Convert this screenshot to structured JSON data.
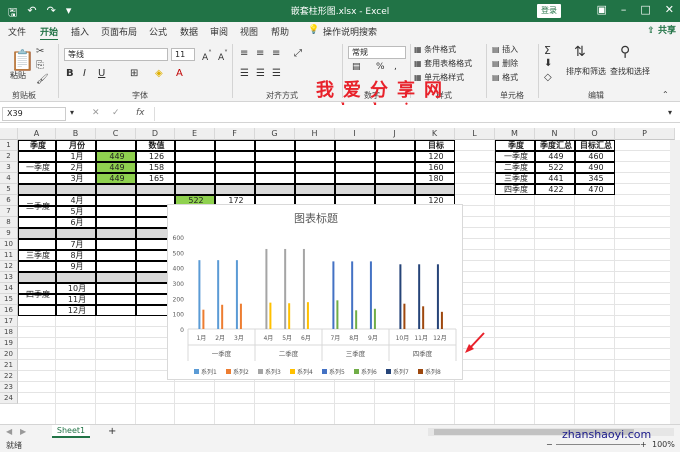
{
  "window": {
    "title": "嵌套柱形图.xlsx  -  Excel",
    "login": "登录"
  },
  "tabs": [
    "文件",
    "开始",
    "插入",
    "页面布局",
    "公式",
    "数据",
    "审阅",
    "视图",
    "帮助"
  ],
  "tell_me": "操作说明搜索",
  "share": "共享",
  "ribbon": {
    "paste": "粘贴",
    "clipboard": "剪贴板",
    "font_name": "等线",
    "font_size": "11",
    "font_group": "字体",
    "align_group": "对齐方式",
    "number_format": "常规",
    "number_group": "数字",
    "cond_format": "条件格式",
    "table_format": "套用表格格式",
    "cell_style": "单元格样式",
    "styles_group": "样式",
    "insert": "插入",
    "delete": "删除",
    "format": "格式",
    "cells_group": "单元格",
    "sort_filter": "排序和筛选",
    "find_select": "查找和选择",
    "edit_group": "编辑"
  },
  "watermark": {
    "cn": "我爱分享网",
    "url": "www.zhanshaoyi.com",
    "url2": "zhanshaoyi.com"
  },
  "formula_bar": {
    "name_box": "X39",
    "fx": "fx"
  },
  "columns": [
    "A",
    "B",
    "C",
    "D",
    "E",
    "F",
    "G",
    "H",
    "I",
    "J",
    "K",
    "L",
    "M",
    "N",
    "O",
    "P"
  ],
  "rows": [
    "1",
    "2",
    "3",
    "4",
    "5",
    "6",
    "7",
    "8",
    "9",
    "10",
    "11",
    "12",
    "13",
    "14",
    "15",
    "16",
    "17",
    "18",
    "19",
    "20",
    "21",
    "22",
    "23",
    "24"
  ],
  "table": {
    "h_quarter": "季度",
    "h_month": "月份",
    "h_value": "数值",
    "h_target": "目标",
    "q1": "一季度",
    "q2": "二季度",
    "q3": "三季度",
    "q4": "四季度",
    "months": [
      "1月",
      "2月",
      "3月",
      "4月",
      "5月",
      "6月",
      "7月",
      "8月",
      "9月",
      "10月",
      "11月",
      "12月"
    ],
    "c_values": [
      "449",
      "449",
      "449"
    ],
    "d_values": [
      "126",
      "158",
      "165"
    ],
    "k_values": [
      "120",
      "160",
      "180",
      "120"
    ],
    "e_value": "522",
    "f_value": "172"
  },
  "summary": {
    "headers": [
      "季度",
      "季度汇总",
      "目标汇总"
    ],
    "rows": [
      [
        "一季度",
        "449",
        "460"
      ],
      [
        "二季度",
        "522",
        "490"
      ],
      [
        "三季度",
        "441",
        "345"
      ],
      [
        "四季度",
        "422",
        "470"
      ]
    ]
  },
  "chart_data": {
    "type": "bar",
    "title": "图表标题",
    "ylim": [
      0,
      600
    ],
    "yticks": [
      "0",
      "100",
      "200",
      "300",
      "400",
      "500",
      "600"
    ],
    "categories": [
      "1月",
      "2月",
      "3月",
      "4月",
      "5月",
      "6月",
      "7月",
      "8月",
      "9月",
      "10月",
      "11月",
      "12月"
    ],
    "groups": [
      "一季度",
      "二季度",
      "三季度",
      "四季度"
    ],
    "series": [
      {
        "name": "系列1",
        "color": "#5b9bd5",
        "values": [
          449,
          449,
          449,
          null,
          null,
          null,
          null,
          null,
          null,
          null,
          null,
          null
        ]
      },
      {
        "name": "系列2",
        "color": "#ed7d31",
        "values": [
          126,
          158,
          165,
          null,
          null,
          null,
          null,
          null,
          null,
          null,
          null,
          null
        ]
      },
      {
        "name": "系列3",
        "color": "#a5a5a5",
        "values": [
          null,
          null,
          null,
          522,
          522,
          522,
          null,
          null,
          null,
          null,
          null,
          null
        ]
      },
      {
        "name": "系列4",
        "color": "#ffc000",
        "values": [
          null,
          null,
          null,
          172,
          168,
          175,
          null,
          null,
          null,
          null,
          null,
          null
        ]
      },
      {
        "name": "系列5",
        "color": "#4472c4",
        "values": [
          null,
          null,
          null,
          null,
          null,
          null,
          441,
          441,
          441,
          null,
          null,
          null
        ]
      },
      {
        "name": "系列6",
        "color": "#70ad47",
        "values": [
          null,
          null,
          null,
          null,
          null,
          null,
          187,
          122,
          132,
          null,
          null,
          null
        ]
      },
      {
        "name": "系列7",
        "color": "#264478",
        "values": [
          null,
          null,
          null,
          null,
          null,
          null,
          null,
          null,
          null,
          422,
          422,
          422
        ]
      },
      {
        "name": "系列8",
        "color": "#9e480e",
        "values": [
          null,
          null,
          null,
          null,
          null,
          null,
          null,
          null,
          null,
          165,
          148,
          112
        ]
      }
    ],
    "legend": "bottom"
  },
  "sheet": {
    "tab": "Sheet1",
    "add": "+"
  },
  "status": {
    "ready": "就绪",
    "zoom": "100%"
  }
}
